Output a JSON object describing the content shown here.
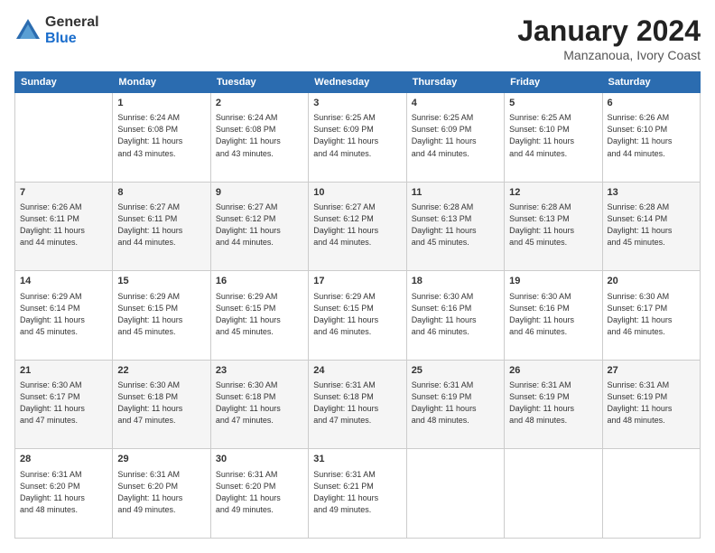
{
  "logo": {
    "general": "General",
    "blue": "Blue"
  },
  "title": "January 2024",
  "subtitle": "Manzanoua, Ivory Coast",
  "days_header": [
    "Sunday",
    "Monday",
    "Tuesday",
    "Wednesday",
    "Thursday",
    "Friday",
    "Saturday"
  ],
  "weeks": [
    [
      {
        "day": "",
        "info": ""
      },
      {
        "day": "1",
        "info": "Sunrise: 6:24 AM\nSunset: 6:08 PM\nDaylight: 11 hours\nand 43 minutes."
      },
      {
        "day": "2",
        "info": "Sunrise: 6:24 AM\nSunset: 6:08 PM\nDaylight: 11 hours\nand 43 minutes."
      },
      {
        "day": "3",
        "info": "Sunrise: 6:25 AM\nSunset: 6:09 PM\nDaylight: 11 hours\nand 44 minutes."
      },
      {
        "day": "4",
        "info": "Sunrise: 6:25 AM\nSunset: 6:09 PM\nDaylight: 11 hours\nand 44 minutes."
      },
      {
        "day": "5",
        "info": "Sunrise: 6:25 AM\nSunset: 6:10 PM\nDaylight: 11 hours\nand 44 minutes."
      },
      {
        "day": "6",
        "info": "Sunrise: 6:26 AM\nSunset: 6:10 PM\nDaylight: 11 hours\nand 44 minutes."
      }
    ],
    [
      {
        "day": "7",
        "info": "Sunrise: 6:26 AM\nSunset: 6:11 PM\nDaylight: 11 hours\nand 44 minutes."
      },
      {
        "day": "8",
        "info": "Sunrise: 6:27 AM\nSunset: 6:11 PM\nDaylight: 11 hours\nand 44 minutes."
      },
      {
        "day": "9",
        "info": "Sunrise: 6:27 AM\nSunset: 6:12 PM\nDaylight: 11 hours\nand 44 minutes."
      },
      {
        "day": "10",
        "info": "Sunrise: 6:27 AM\nSunset: 6:12 PM\nDaylight: 11 hours\nand 44 minutes."
      },
      {
        "day": "11",
        "info": "Sunrise: 6:28 AM\nSunset: 6:13 PM\nDaylight: 11 hours\nand 45 minutes."
      },
      {
        "day": "12",
        "info": "Sunrise: 6:28 AM\nSunset: 6:13 PM\nDaylight: 11 hours\nand 45 minutes."
      },
      {
        "day": "13",
        "info": "Sunrise: 6:28 AM\nSunset: 6:14 PM\nDaylight: 11 hours\nand 45 minutes."
      }
    ],
    [
      {
        "day": "14",
        "info": "Sunrise: 6:29 AM\nSunset: 6:14 PM\nDaylight: 11 hours\nand 45 minutes."
      },
      {
        "day": "15",
        "info": "Sunrise: 6:29 AM\nSunset: 6:15 PM\nDaylight: 11 hours\nand 45 minutes."
      },
      {
        "day": "16",
        "info": "Sunrise: 6:29 AM\nSunset: 6:15 PM\nDaylight: 11 hours\nand 45 minutes."
      },
      {
        "day": "17",
        "info": "Sunrise: 6:29 AM\nSunset: 6:15 PM\nDaylight: 11 hours\nand 46 minutes."
      },
      {
        "day": "18",
        "info": "Sunrise: 6:30 AM\nSunset: 6:16 PM\nDaylight: 11 hours\nand 46 minutes."
      },
      {
        "day": "19",
        "info": "Sunrise: 6:30 AM\nSunset: 6:16 PM\nDaylight: 11 hours\nand 46 minutes."
      },
      {
        "day": "20",
        "info": "Sunrise: 6:30 AM\nSunset: 6:17 PM\nDaylight: 11 hours\nand 46 minutes."
      }
    ],
    [
      {
        "day": "21",
        "info": "Sunrise: 6:30 AM\nSunset: 6:17 PM\nDaylight: 11 hours\nand 47 minutes."
      },
      {
        "day": "22",
        "info": "Sunrise: 6:30 AM\nSunset: 6:18 PM\nDaylight: 11 hours\nand 47 minutes."
      },
      {
        "day": "23",
        "info": "Sunrise: 6:30 AM\nSunset: 6:18 PM\nDaylight: 11 hours\nand 47 minutes."
      },
      {
        "day": "24",
        "info": "Sunrise: 6:31 AM\nSunset: 6:18 PM\nDaylight: 11 hours\nand 47 minutes."
      },
      {
        "day": "25",
        "info": "Sunrise: 6:31 AM\nSunset: 6:19 PM\nDaylight: 11 hours\nand 48 minutes."
      },
      {
        "day": "26",
        "info": "Sunrise: 6:31 AM\nSunset: 6:19 PM\nDaylight: 11 hours\nand 48 minutes."
      },
      {
        "day": "27",
        "info": "Sunrise: 6:31 AM\nSunset: 6:19 PM\nDaylight: 11 hours\nand 48 minutes."
      }
    ],
    [
      {
        "day": "28",
        "info": "Sunrise: 6:31 AM\nSunset: 6:20 PM\nDaylight: 11 hours\nand 48 minutes."
      },
      {
        "day": "29",
        "info": "Sunrise: 6:31 AM\nSunset: 6:20 PM\nDaylight: 11 hours\nand 49 minutes."
      },
      {
        "day": "30",
        "info": "Sunrise: 6:31 AM\nSunset: 6:20 PM\nDaylight: 11 hours\nand 49 minutes."
      },
      {
        "day": "31",
        "info": "Sunrise: 6:31 AM\nSunset: 6:21 PM\nDaylight: 11 hours\nand 49 minutes."
      },
      {
        "day": "",
        "info": ""
      },
      {
        "day": "",
        "info": ""
      },
      {
        "day": "",
        "info": ""
      }
    ]
  ]
}
